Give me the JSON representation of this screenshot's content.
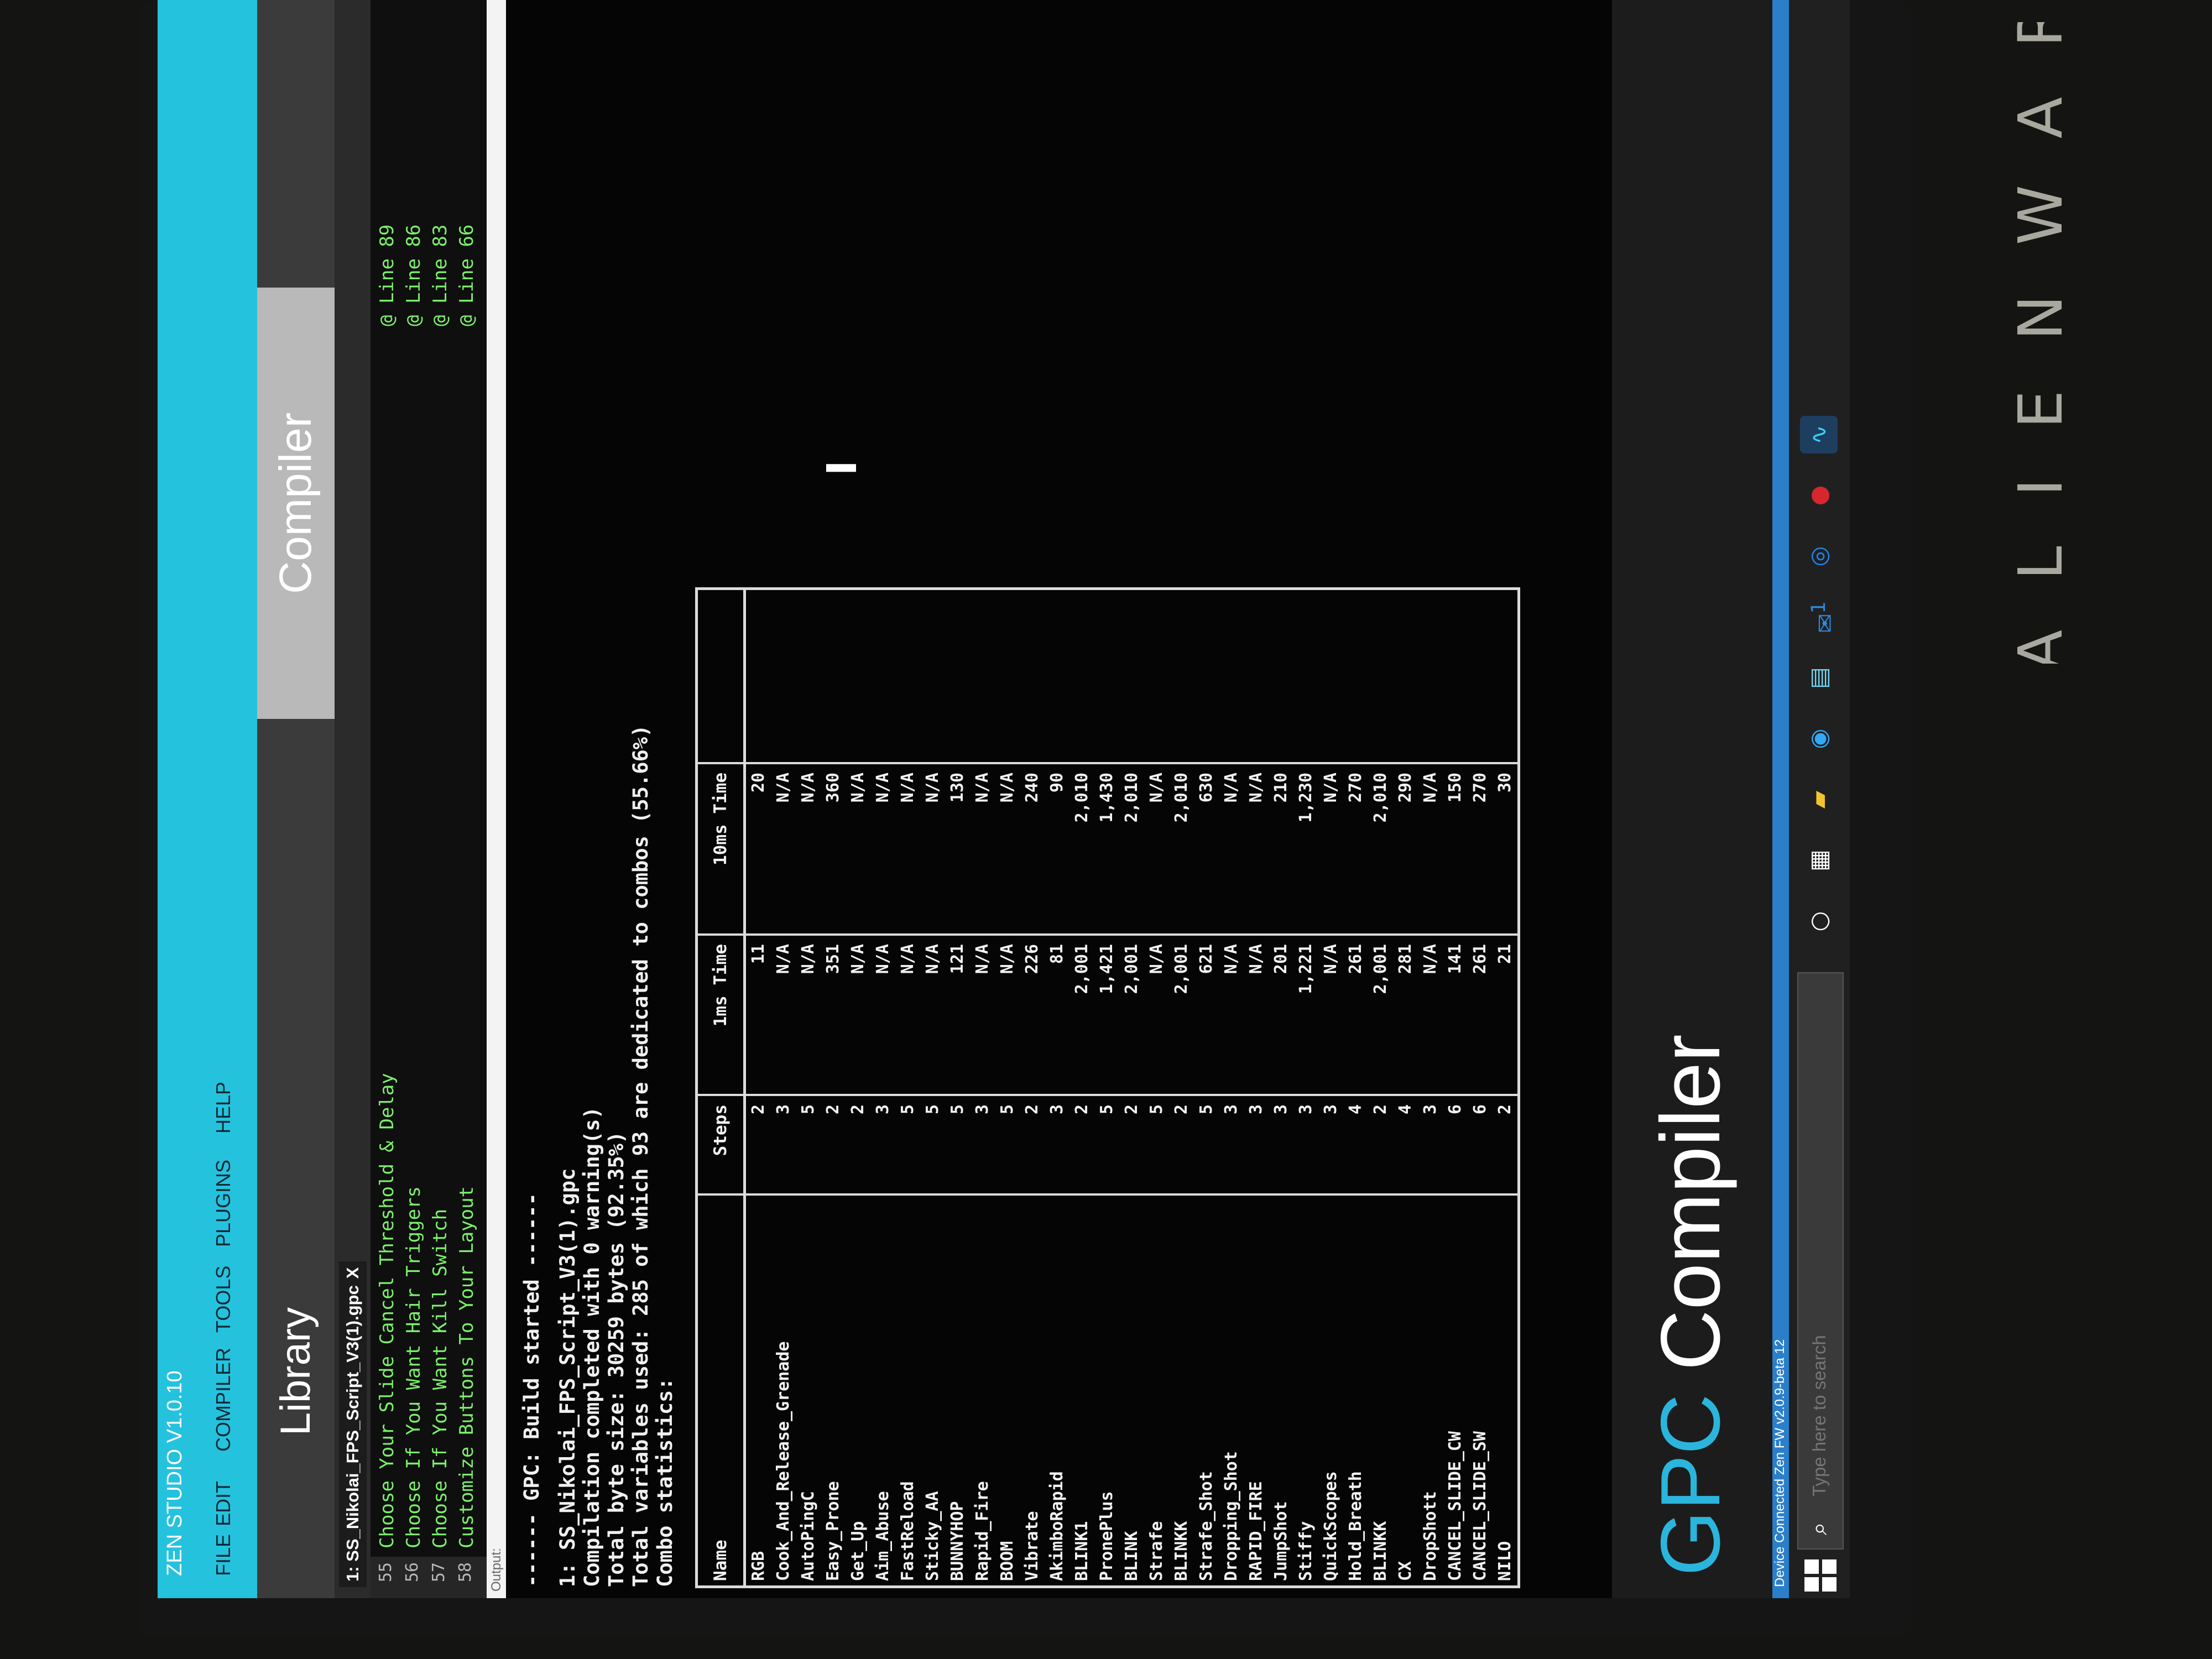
{
  "device_brand": "ALIENWARE",
  "app": {
    "title": "ZEN STUDIO V1.0.10",
    "menu": [
      "FILE",
      "EDIT",
      "COMPILER",
      "TOOLS",
      "PLUGINS",
      "HELP"
    ]
  },
  "nav": {
    "library": "Library",
    "compiler": "Compiler"
  },
  "editor": {
    "tab": "1: SS_Nikolai_FPS_Script_V3(1).gpc",
    "tab_close": "X",
    "lines": [
      {
        "num": "55",
        "text": "Choose Your Slide Cancel Threshold & Delay",
        "ref": "@ Line 89"
      },
      {
        "num": "56",
        "text": "Choose If You Want Hair Triggers",
        "ref": "@ Line 86"
      },
      {
        "num": "57",
        "text": "Choose If You Want Kill Switch",
        "ref": "@ Line 83"
      },
      {
        "num": "58",
        "text": "Customize Buttons To Your Layout",
        "ref": "@ Line 66"
      }
    ]
  },
  "output": {
    "label": "Output:",
    "lines": [
      "------ GPC: Build started ------",
      "1: SS_Nikolai_FPS_Script_V3(1).gpc",
      "Compilation completed with 0 warning(s)",
      "Total byte size: 30259 bytes (92.35%)",
      "Total variables used: 285 of which 93 are dedicated to combos (55.66%)",
      "Combo statistics:"
    ],
    "cursor": "I",
    "table": {
      "headers": [
        "Name",
        "Steps",
        "1ms Time",
        "10ms Time"
      ],
      "rows": [
        [
          "RGB",
          "2",
          "11",
          "20"
        ],
        [
          "Cook_And_Release_Grenade",
          "3",
          "N/A",
          "N/A"
        ],
        [
          "AutoPingC",
          "5",
          "N/A",
          "N/A"
        ],
        [
          "Easy_Prone",
          "2",
          "351",
          "360"
        ],
        [
          "Get_Up",
          "2",
          "N/A",
          "N/A"
        ],
        [
          "Aim_Abuse",
          "3",
          "N/A",
          "N/A"
        ],
        [
          "FastReload",
          "5",
          "N/A",
          "N/A"
        ],
        [
          "Sticky_AA",
          "5",
          "N/A",
          "N/A"
        ],
        [
          "BUNNYHOP",
          "5",
          "121",
          "130"
        ],
        [
          "Rapid_Fire",
          "3",
          "N/A",
          "N/A"
        ],
        [
          "BOOM",
          "5",
          "N/A",
          "N/A"
        ],
        [
          "Vibrate",
          "2",
          "226",
          "240"
        ],
        [
          "AkimboRapid",
          "3",
          "81",
          "90"
        ],
        [
          "BLINK1",
          "2",
          "2,001",
          "2,010"
        ],
        [
          "PronePlus",
          "5",
          "1,421",
          "1,430"
        ],
        [
          "BLINK",
          "2",
          "2,001",
          "2,010"
        ],
        [
          "Strafe",
          "5",
          "N/A",
          "N/A"
        ],
        [
          "BLINKK",
          "2",
          "2,001",
          "2,010"
        ],
        [
          "Strafe_Shot",
          "5",
          "621",
          "630"
        ],
        [
          "Dropping_Shot",
          "3",
          "N/A",
          "N/A"
        ],
        [
          "RAPID_FIRE",
          "3",
          "N/A",
          "N/A"
        ],
        [
          "JumpShot",
          "3",
          "201",
          "210"
        ],
        [
          "Stiffy",
          "3",
          "1,221",
          "1,230"
        ],
        [
          "QuickScopes",
          "3",
          "N/A",
          "N/A"
        ],
        [
          "Hold_Breath",
          "4",
          "261",
          "270"
        ],
        [
          "BLINKK",
          "2",
          "2,001",
          "2,010"
        ],
        [
          "CX",
          "4",
          "281",
          "290"
        ],
        [
          "DropShott",
          "3",
          "N/A",
          "N/A"
        ],
        [
          "CANCEL_SLIDE_CW",
          "6",
          "141",
          "150"
        ],
        [
          "CANCEL_SLIDE_SW",
          "6",
          "261",
          "270"
        ],
        [
          "NILO",
          "2",
          "21",
          "30"
        ]
      ]
    }
  },
  "brandbar": {
    "gpc": "GPC",
    "compiler": "Compiler"
  },
  "status": {
    "text": "Device Connected Zen FW v2.0.9-beta 12"
  },
  "taskbar": {
    "search_placeholder": "Type here to search",
    "icons": [
      "windows-start-icon",
      "cortana-icon",
      "task-view-icon",
      "file-explorer-icon",
      "edge-icon",
      "store-icon",
      "mail-icon",
      "steam-icon",
      "security-app-icon",
      "zen-studio-icon"
    ],
    "mail_badge": "1"
  }
}
